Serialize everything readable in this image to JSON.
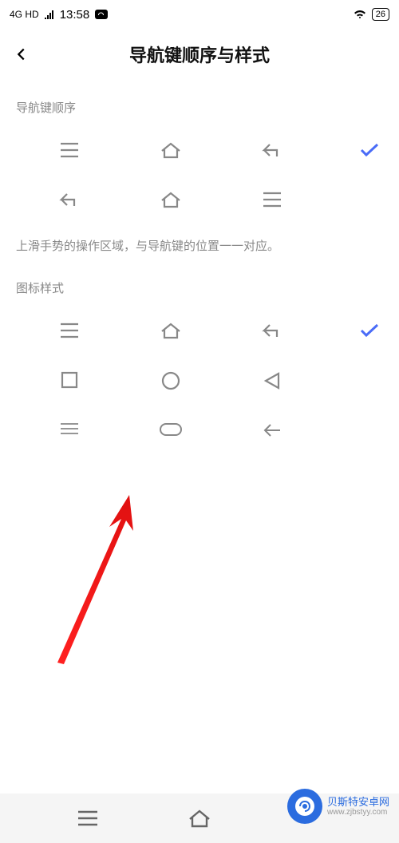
{
  "status": {
    "network": "4G HD",
    "time": "13:58",
    "battery": "26"
  },
  "header": {
    "title": "导航键顺序与样式"
  },
  "sections": {
    "order_label": "导航键顺序",
    "hint": "上滑手势的操作区域，与导航键的位置一一对应。",
    "style_label": "图标样式"
  },
  "order_options": [
    {
      "icons": [
        "menu",
        "home",
        "back"
      ],
      "selected": true
    },
    {
      "icons": [
        "back",
        "home",
        "menu"
      ],
      "selected": false
    }
  ],
  "style_options": [
    {
      "icons": [
        "menu",
        "home",
        "back"
      ],
      "selected": true
    },
    {
      "icons": [
        "square",
        "circle",
        "triangle"
      ],
      "selected": false
    },
    {
      "icons": [
        "thin-menu",
        "pill",
        "arrow-left"
      ],
      "selected": false
    }
  ],
  "watermark": {
    "name": "贝斯特安卓网",
    "url": "www.zjbstyy.com"
  }
}
